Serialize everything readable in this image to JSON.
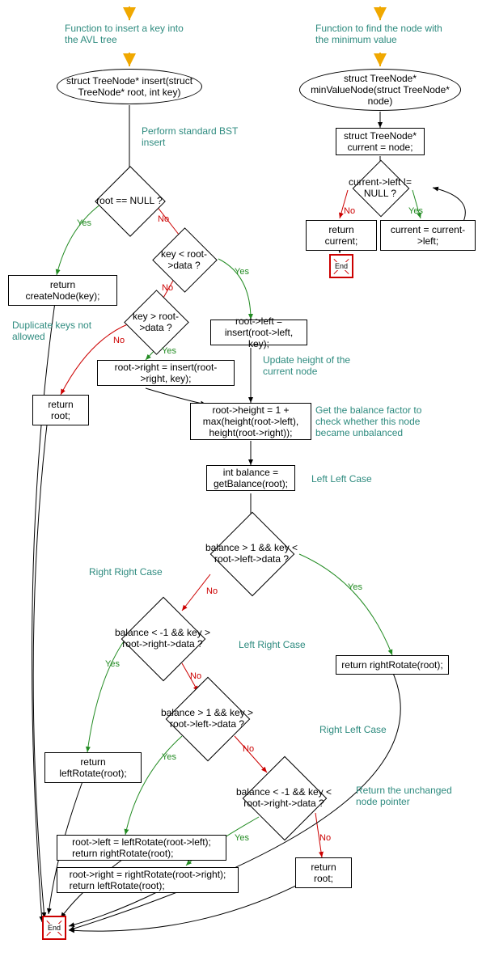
{
  "left_flow": {
    "start_comment": "Function to insert a key into the AVL tree",
    "func_sig": "struct TreeNode* insert(struct TreeNode* root, int key)",
    "bst_comment": "Perform standard BST insert",
    "cond_root_null": "root == NULL ?",
    "ret_create": "return createNode(key);",
    "cond_key_lt": "key < root->data ?",
    "cond_key_gt": "key > root->data ?",
    "dup_comment": "Duplicate keys not allowed",
    "ret_root1": "return root;",
    "assign_right": "root->right = insert(root->right, key);",
    "assign_left": "root->left = insert(root->left, key);",
    "update_h_comment": "Update height of the current node",
    "update_h": "root->height = 1 + max(height(root->left), height(root->right));",
    "balance_comment": "Get the balance factor to check whether this node became unbalanced",
    "balance_assign": "int balance = getBalance(root);",
    "ll_comment": "Left Left Case",
    "cond_ll": "balance > 1 && key < root->left->data ?",
    "ret_rr": "return rightRotate(root);",
    "rr_comment": "Right Right Case",
    "cond_rr": "balance < -1 && key > root->right->data ?",
    "ret_lr": "return leftRotate(root);",
    "lr_comment": "Left Right Case",
    "cond_lr": "balance > 1 && key > root->left->data ?",
    "lr_block": "root->left = leftRotate(root->left);\nreturn rightRotate(root);",
    "rl_comment": "Right Left Case",
    "cond_rl": "balance < -1 && key < root->right->data ?",
    "rl_block": "root->right = rightRotate(root->right);\nreturn leftRotate(root);",
    "unchanged_comment": "Return the unchanged node pointer",
    "ret_root2": "return root;",
    "end": "End"
  },
  "right_flow": {
    "start_comment": "Function to find the node with the minimum value",
    "func_sig": "struct TreeNode* minValueNode(struct TreeNode* node)",
    "assign_current": "struct TreeNode* current = node;",
    "cond_left": "current->left != NULL ?",
    "ret_current": "return current;",
    "assign_left": "current = current->left;",
    "end": "End"
  },
  "labels": {
    "yes": "Yes",
    "no": "No"
  },
  "colors": {
    "comment": "#2e8b7f",
    "yes": "#228B22",
    "no": "#cc0000",
    "arrow_entry": "#f0a800"
  }
}
